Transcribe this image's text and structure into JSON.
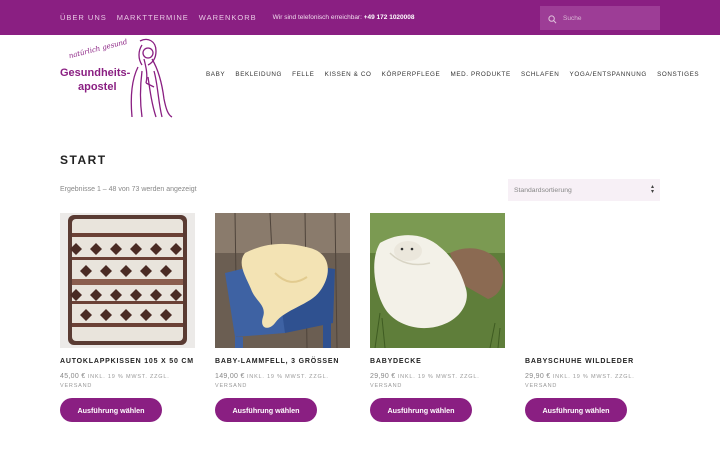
{
  "topbar": {
    "nav": [
      "Über uns",
      "Markttermine",
      "Warenkorb"
    ],
    "phone_label": "Wir sind telefonisch erreichbar:",
    "phone_number": "+49 172 1020008",
    "search_placeholder": "Suche"
  },
  "logo": {
    "script": "natürlich gesund",
    "line1": "Gesundheits-",
    "line2": "apostel"
  },
  "mainnav": [
    "Baby",
    "Bekleidung",
    "Felle",
    "Kissen & Co",
    "Körperpflege",
    "Med. Produkte",
    "Schlafen",
    "Yoga/Entspannung",
    "Sonstiges"
  ],
  "page": {
    "title": "START",
    "result_count": "Ergebnisse 1 – 48 von 73 werden angezeigt",
    "sort_selected": "Standardsortierung"
  },
  "products": [
    {
      "name": "Autoklappkissen 105 x 50 cm",
      "price": "45,00 €",
      "tax_note": "inkl. 19 % MwSt. zzgl.",
      "shipping": "Versand",
      "button": "Ausführung wählen"
    },
    {
      "name": "Baby-Lammfell, 3 Grössen",
      "price": "149,00 €",
      "tax_note": "inkl. 19 % MwSt. zzgl.",
      "shipping": "Versand",
      "button": "Ausführung wählen"
    },
    {
      "name": "Babydecke",
      "price": "29,90 €",
      "tax_note": "inkl. 19 % MwSt. zzgl.",
      "shipping": "Versand",
      "button": "Ausführung wählen"
    },
    {
      "name": "Babyschuhe Wildleder",
      "price": "29,90 €",
      "tax_note": "inkl. 19 % MwSt. zzgl.",
      "shipping": "Versand",
      "button": "Ausführung wählen"
    }
  ],
  "colors": {
    "brand": "#8a1f82"
  }
}
